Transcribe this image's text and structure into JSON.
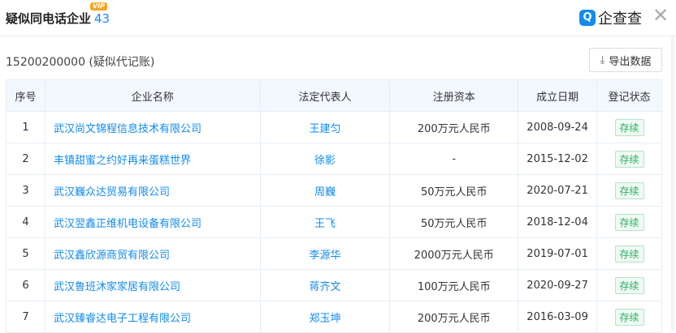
{
  "header": {
    "title": "疑似同电话企业",
    "count": "43",
    "vip": "VIP",
    "brand": "企查查",
    "brand_icon": "Q",
    "close": "✕"
  },
  "subtitle": "15200200000 (疑似代记账)",
  "export_label": "导出数据",
  "columns": [
    "序号",
    "企业名称",
    "法定代表人",
    "注册资本",
    "成立日期",
    "登记状态"
  ],
  "rows": [
    {
      "no": "1",
      "name": "武汉尚文锦程信息技术有限公司",
      "rep": "王建匀",
      "capital": "200万元人民币",
      "date": "2008-09-24",
      "status": "存续"
    },
    {
      "no": "2",
      "name": "丰镇甜蜜之约好再来蛋糕世界",
      "rep": "徐影",
      "capital": "-",
      "date": "2015-12-02",
      "status": "存续"
    },
    {
      "no": "3",
      "name": "武汉巍众达贸易有限公司",
      "rep": "周巍",
      "capital": "50万元人民币",
      "date": "2020-07-21",
      "status": "存续"
    },
    {
      "no": "4",
      "name": "武汉翌鑫正维机电设备有限公司",
      "rep": "王飞",
      "capital": "50万元人民币",
      "date": "2018-12-04",
      "status": "存续"
    },
    {
      "no": "5",
      "name": "武汉鑫欣源商贸有限公司",
      "rep": "李源华",
      "capital": "2000万元人民币",
      "date": "2019-07-01",
      "status": "存续"
    },
    {
      "no": "6",
      "name": "武汉鲁班沐家家居有限公司",
      "rep": "蒋齐文",
      "capital": "100万元人民币",
      "date": "2020-09-27",
      "status": "存续"
    },
    {
      "no": "7",
      "name": "武汉臻睿达电子工程有限公司",
      "rep": "郑玉坤",
      "capital": "200万元人民币",
      "date": "2016-03-09",
      "status": "存续"
    }
  ]
}
